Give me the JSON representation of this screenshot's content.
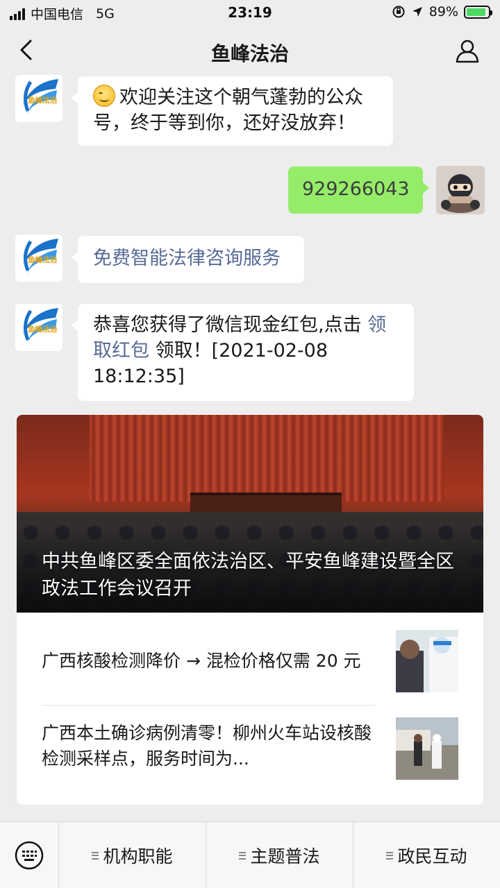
{
  "status_bar": {
    "carrier": "中国电信",
    "network": "5G",
    "time": "23:19",
    "battery_text": "89%",
    "battery_level": 0.89
  },
  "nav": {
    "title": "鱼峰法治"
  },
  "account": {
    "logo_text": "鱼峰法治"
  },
  "messages": {
    "welcome": "欢迎关注这个朝气蓬勃的公众号，终于等到你，还好没放弃！",
    "user_number": "929266043",
    "service_link": "免费智能法律咨询服务",
    "redpacket_prefix": "恭喜您获得了微信现金红包,点击 ",
    "redpacket_link": "领取红包",
    "redpacket_suffix": " 领取！[2021-02-08 18:12:35]"
  },
  "news": {
    "hero_title": "中共鱼峰区委全面依法治区、平安鱼峰建设暨全区政法工作会议召开",
    "items": [
      {
        "title": "广西核酸检测降价 → 混检价格仅需 20 元"
      },
      {
        "title": "广西本土确诊病例清零！柳州火车站设核酸检测采样点，服务时间为..."
      }
    ]
  },
  "menu": {
    "items": [
      {
        "label": "机构职能"
      },
      {
        "label": "主题普法"
      },
      {
        "label": "政民互动"
      }
    ]
  },
  "colors": {
    "background": "#ededed",
    "bubble_green": "#95ec69",
    "link": "#576b95",
    "logo_blue": "#1a73c9",
    "logo_gold": "#e0a51c"
  }
}
